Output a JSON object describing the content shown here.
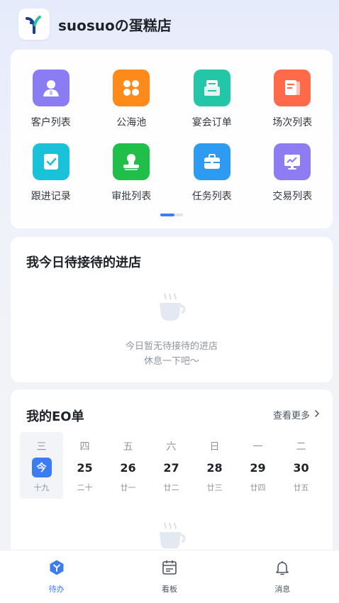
{
  "header": {
    "shop_name": "suosuoの蛋糕店",
    "logo_icon": "app-logo-icon"
  },
  "menu": {
    "items": [
      {
        "label": "客户列表",
        "icon": "customer-icon",
        "color": "#8a7df4"
      },
      {
        "label": "公海池",
        "icon": "clover-icon",
        "color": "#ff8a1c"
      },
      {
        "label": "宴会订单",
        "icon": "banquet-order-icon",
        "color": "#23c7a8"
      },
      {
        "label": "场次列表",
        "icon": "session-list-icon",
        "color": "#ff6a4a"
      },
      {
        "label": "跟进记录",
        "icon": "follow-up-icon",
        "color": "#19c2d8"
      },
      {
        "label": "审批列表",
        "icon": "approval-icon",
        "color": "#1fbf4a"
      },
      {
        "label": "任务列表",
        "icon": "briefcase-icon",
        "color": "#2d9bf0"
      },
      {
        "label": "交易列表",
        "icon": "trade-chart-icon",
        "color": "#8d7cf2"
      }
    ],
    "page_count": 2,
    "current_page": 1
  },
  "visit": {
    "title": "我今日待接待的进店",
    "empty_line1": "今日暂无待接待的进店",
    "empty_line2": "休息一下吧～"
  },
  "eo": {
    "title": "我的EO单",
    "more": "查看更多",
    "days": [
      {
        "weekday": "三",
        "date": "今",
        "lunar": "十九",
        "selected": true
      },
      {
        "weekday": "四",
        "date": "25",
        "lunar": "二十"
      },
      {
        "weekday": "五",
        "date": "26",
        "lunar": "廿一"
      },
      {
        "weekday": "六",
        "date": "27",
        "lunar": "廿二"
      },
      {
        "weekday": "日",
        "date": "28",
        "lunar": "廿三"
      },
      {
        "weekday": "一",
        "date": "29",
        "lunar": "廿四"
      },
      {
        "weekday": "二",
        "date": "30",
        "lunar": "廿五"
      }
    ]
  },
  "tabs": [
    {
      "label": "待办",
      "icon": "todo-cube-icon",
      "active": true
    },
    {
      "label": "看板",
      "icon": "calendar-board-icon"
    },
    {
      "label": "消息",
      "icon": "bell-icon"
    }
  ],
  "colors": {
    "accent": "#3b7cf5",
    "muted": "#8f959e"
  }
}
